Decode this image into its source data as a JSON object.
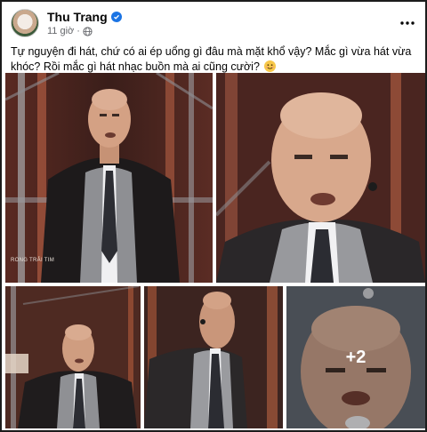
{
  "post": {
    "author": "Thu Trang",
    "time": "11 giờ",
    "caption": "Tự nguyện đi hát, chứ có ai ép uổng gì đâu mà mặt khổ vậy? Mắc gì vừa hát vừa khóc? Rồi mắc gì hát nhạc buồn mà ai cũng cười?",
    "emoji": "smiling-face",
    "more_photos": "+2",
    "watermark": "RONG TRẢI TIM"
  },
  "icons": {
    "verified": "verified-badge-icon",
    "privacy": "globe-icon",
    "menu": "more-options-icon"
  },
  "colors": {
    "verified": "#1b74e4",
    "secondary_text": "#65676b",
    "stage_red": "#7a2a1f"
  }
}
